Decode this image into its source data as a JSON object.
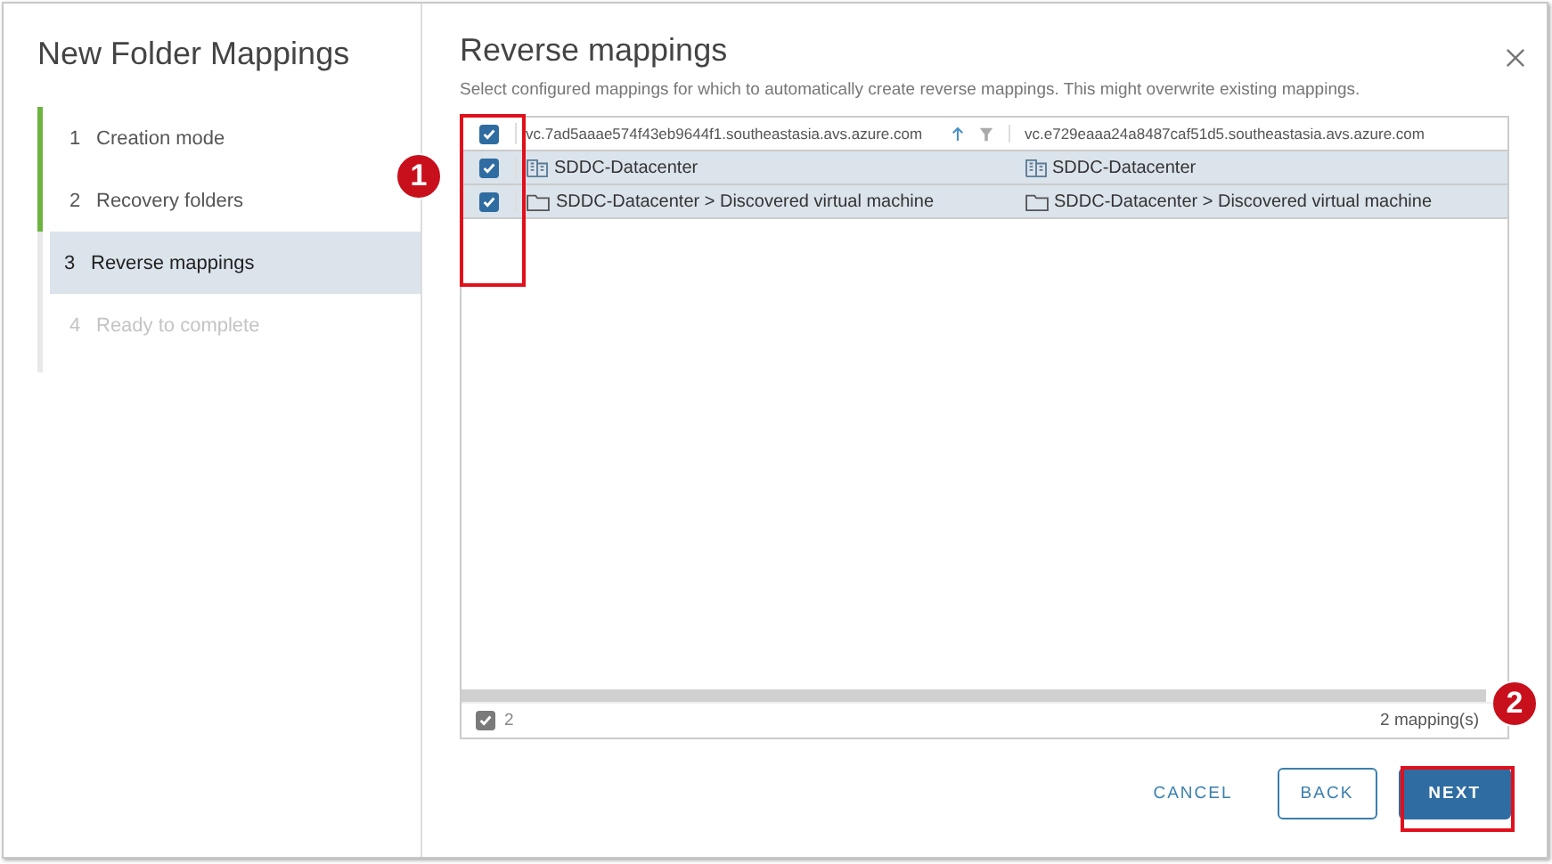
{
  "dialog_title": "New Folder Mappings",
  "steps": [
    {
      "number": "1",
      "label": "Creation mode",
      "completed": true,
      "disabled": false,
      "selected": false
    },
    {
      "number": "2",
      "label": "Recovery folders",
      "completed": true,
      "disabled": false,
      "selected": false
    },
    {
      "number": "3",
      "label": "Reverse mappings",
      "completed": false,
      "disabled": false,
      "selected": true
    },
    {
      "number": "4",
      "label": "Ready to complete",
      "completed": false,
      "disabled": true,
      "selected": false
    }
  ],
  "page": {
    "title": "Reverse mappings",
    "description": "Select configured mappings for which to automatically create reverse mappings. This might overwrite existing mappings."
  },
  "table": {
    "select_all_checked": true,
    "columns": [
      {
        "label": "vc.7ad5aaae574f43eb9644f1.southeastasia.avs.azure.com",
        "sorted": true,
        "filter": true
      },
      {
        "label": "vc.e729eaaa24a8487caf51d5.southeastasia.avs.azure.com",
        "sorted": false,
        "filter": false
      }
    ],
    "rows": [
      {
        "checked": true,
        "kind": "datacenter",
        "cells": [
          "SDDC-Datacenter",
          "SDDC-Datacenter"
        ]
      },
      {
        "checked": true,
        "kind": "folder",
        "cells": [
          "SDDC-Datacenter > Discovered virtual machine",
          "SDDC-Datacenter > Discovered virtual machine"
        ]
      }
    ],
    "footer": {
      "selected_count": "2",
      "total": "2 mapping(s)"
    }
  },
  "buttons": [
    {
      "label": "CANCEL",
      "kind": "link"
    },
    {
      "label": "BACK",
      "kind": "outline"
    },
    {
      "label": "NEXT",
      "kind": "primary"
    }
  ],
  "callouts": [
    {
      "label": "1"
    },
    {
      "label": "2"
    }
  ]
}
